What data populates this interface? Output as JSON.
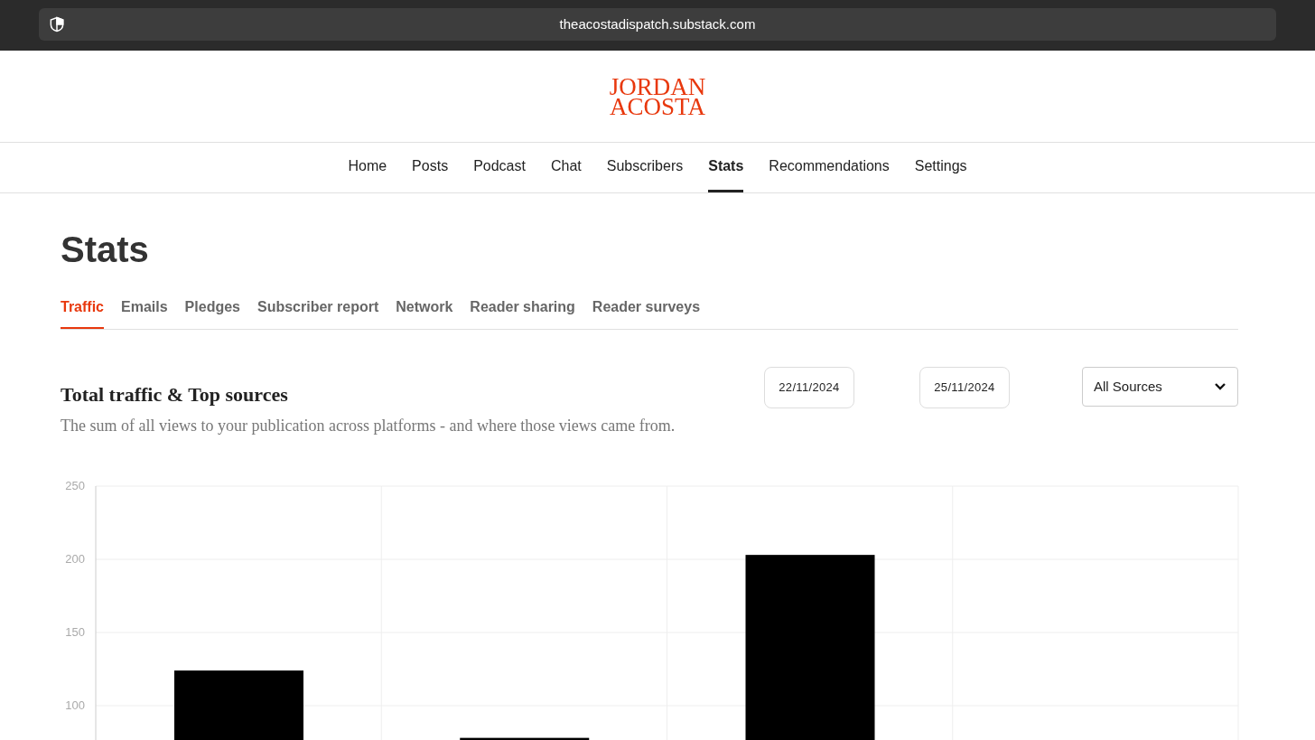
{
  "browser": {
    "url": "theacostadispatch.substack.com"
  },
  "logo": {
    "lines": [
      "JORDAN",
      "ACOSTA"
    ]
  },
  "nav": [
    {
      "label": "Home",
      "selected": false
    },
    {
      "label": "Posts",
      "selected": false
    },
    {
      "label": "Podcast",
      "selected": false
    },
    {
      "label": "Chat",
      "selected": false
    },
    {
      "label": "Subscribers",
      "selected": false
    },
    {
      "label": "Stats",
      "selected": true
    },
    {
      "label": "Recommendations",
      "selected": false
    },
    {
      "label": "Settings",
      "selected": false
    }
  ],
  "page_title": "Stats",
  "tabs": [
    {
      "label": "Traffic",
      "selected": true
    },
    {
      "label": "Emails",
      "selected": false
    },
    {
      "label": "Pledges",
      "selected": false
    },
    {
      "label": "Subscriber report",
      "selected": false
    },
    {
      "label": "Network",
      "selected": false
    },
    {
      "label": "Reader sharing",
      "selected": false
    },
    {
      "label": "Reader surveys",
      "selected": false
    }
  ],
  "section": {
    "title": "Total traffic & Top sources",
    "description": "The sum of all views to your publication across platforms - and where those views came from.",
    "start_date": "22/11/2024",
    "end_date": "25/11/2024",
    "source_select": "All Sources",
    "chart_data": {
      "type": "bar",
      "grid": true,
      "values": [
        124,
        78,
        203,
        null
      ],
      "ylim": [
        0,
        250
      ],
      "yticks": [
        100,
        150,
        200,
        250
      ]
    }
  }
}
